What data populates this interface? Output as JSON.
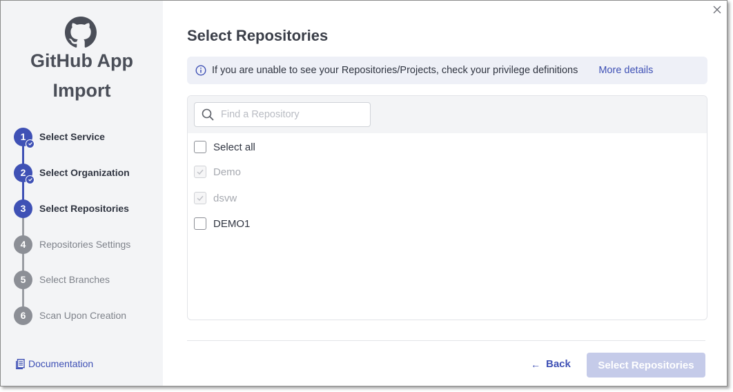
{
  "sidebar": {
    "app_title_line1": "GitHub App",
    "app_title_line2": "Import",
    "logo_icon": "github-icon",
    "steps": [
      {
        "number": "1",
        "label": "Select Service",
        "state": "completed"
      },
      {
        "number": "2",
        "label": "Select Organization",
        "state": "completed"
      },
      {
        "number": "3",
        "label": "Select Repositories",
        "state": "current"
      },
      {
        "number": "4",
        "label": "Repositories Settings",
        "state": "pending"
      },
      {
        "number": "5",
        "label": "Select Branches",
        "state": "pending"
      },
      {
        "number": "6",
        "label": "Scan Upon Creation",
        "state": "pending"
      }
    ],
    "documentation_label": "Documentation"
  },
  "main": {
    "title": "Select Repositories",
    "info": {
      "text": "If you are unable to see your Repositories/Projects, check your privilege definitions",
      "link": "More details"
    },
    "search": {
      "placeholder": "Find a Repository",
      "value": ""
    },
    "select_all_label": "Select all",
    "repositories": [
      {
        "name": "Demo",
        "checked": true,
        "disabled": true
      },
      {
        "name": "dsvw",
        "checked": true,
        "disabled": true
      },
      {
        "name": "DEMO1",
        "checked": false,
        "disabled": false
      }
    ]
  },
  "footer": {
    "back_label": "Back",
    "primary_label": "Select Repositories"
  },
  "colors": {
    "accent": "#3f51b5",
    "inactive_step": "#8c8f96",
    "primary_disabled": "#c5cbe9",
    "sidebar_bg": "#f3f4f6"
  }
}
